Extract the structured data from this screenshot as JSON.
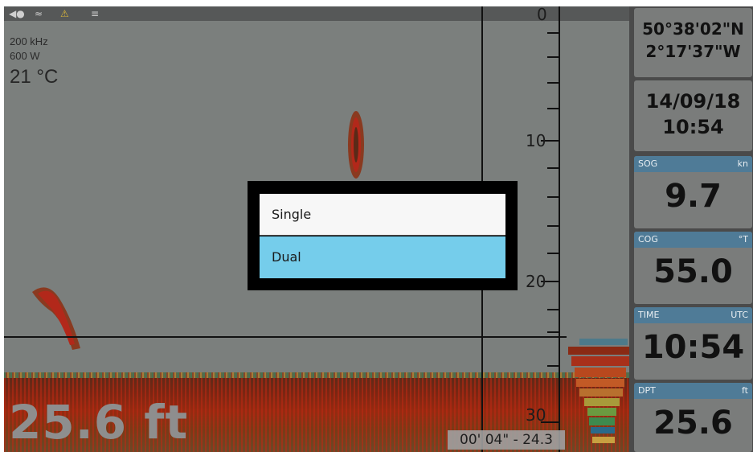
{
  "status_icons": [
    "fish-icon",
    "wifi-icon",
    "boat-warning-icon",
    "signal-icon"
  ],
  "sonar": {
    "frequency": "200 kHz",
    "power": "600 W",
    "water_temp": "21 °C",
    "depth_scale": [
      "0",
      "10",
      "20",
      "30"
    ],
    "current_depth": "25.6 ft",
    "cursor_readout": "00' 04\" - 24.3"
  },
  "panel": {
    "position_lat": "50°38'02\"N",
    "position_lon": "2°17'37\"W",
    "date": "14/09/18",
    "time": "10:54",
    "sog": {
      "label": "SOG",
      "unit": "kn",
      "value": "9.7"
    },
    "cog": {
      "label": "COG",
      "unit": "°T",
      "value": "55.0"
    },
    "clock": {
      "label": "TIME",
      "unit": "UTC",
      "value": "10:54"
    },
    "dpt": {
      "label": "DPT",
      "unit": "ft",
      "value": "25.6"
    }
  },
  "dialog": {
    "options": [
      "Single",
      "Dual"
    ],
    "selected": "Dual"
  },
  "colors": {
    "selected_option": "#75cdeb",
    "card_header": "#4f7b97"
  }
}
